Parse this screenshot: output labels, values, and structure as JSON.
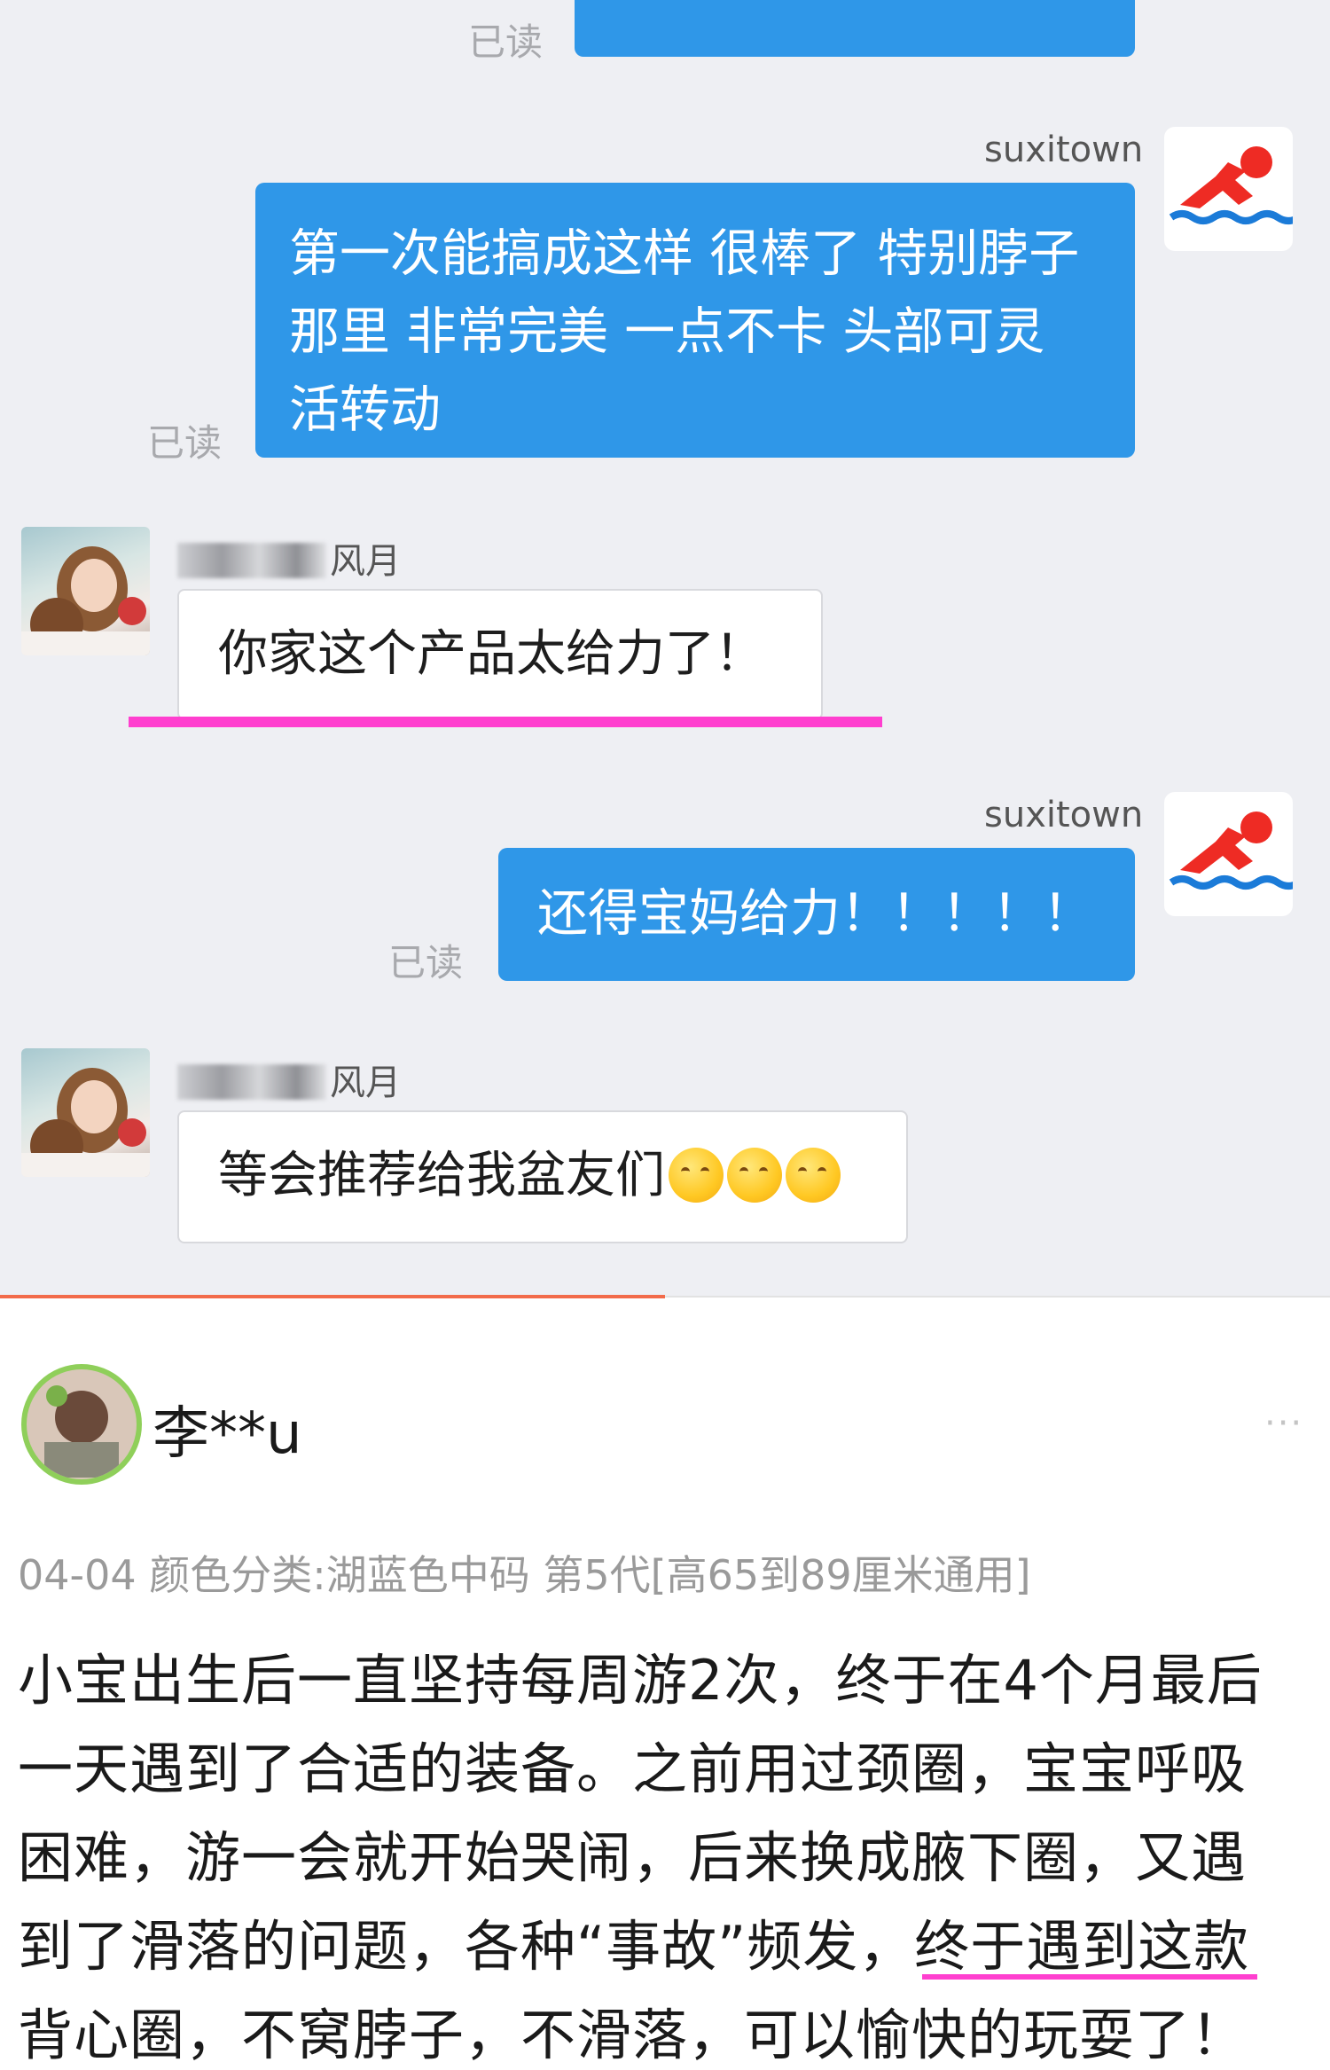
{
  "chat": {
    "top_read": "已读",
    "messages": [
      {
        "sender": "suxitown",
        "text_lines": [
          "第一次能搞成这样 很棒了 特别脖子",
          "那里  非常完美 一点不卡 头部可灵",
          "活转动"
        ],
        "read": "已读"
      },
      {
        "sender_suffix": "风月",
        "text": "你家这个产品太给力了！"
      },
      {
        "sender": "suxitown",
        "text": "还得宝妈给力！！！！！",
        "read": "已读"
      },
      {
        "sender_suffix": "风月",
        "text": "等会推荐给我盆友们"
      }
    ],
    "colors": {
      "bubble": "#2f97e8",
      "highlight": "#ff3fcf"
    }
  },
  "review": {
    "username": "李**u",
    "more": "···",
    "meta": "04-04 颜色分类:湖蓝色中码 第5代[高65到89厘米通用]",
    "body_lines": [
      "小宝出生后一直坚持每周游2次，终于在4个月最后",
      "一天遇到了合适的装备。之前用过颈圈，宝宝呼吸",
      "困难，游一会就开始哭闹，后来换成腋下圈，又遇",
      "到了滑落的问题，各种“事故”频发，终于遇到这款",
      "背心圈，不窝脖子，不滑落，可以愉快的玩耍了！"
    ]
  }
}
